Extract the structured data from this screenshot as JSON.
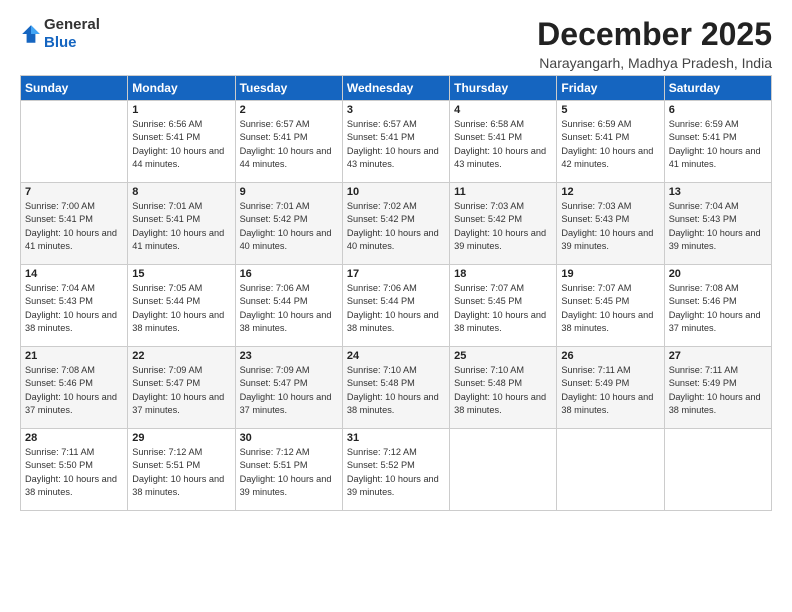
{
  "logo": {
    "general": "General",
    "blue": "Blue"
  },
  "header": {
    "month": "December 2025",
    "location": "Narayangarh, Madhya Pradesh, India"
  },
  "days_of_week": [
    "Sunday",
    "Monday",
    "Tuesday",
    "Wednesday",
    "Thursday",
    "Friday",
    "Saturday"
  ],
  "weeks": [
    [
      {
        "day": "",
        "content": ""
      },
      {
        "day": "1",
        "content": "Sunrise: 6:56 AM\nSunset: 5:41 PM\nDaylight: 10 hours\nand 44 minutes."
      },
      {
        "day": "2",
        "content": "Sunrise: 6:57 AM\nSunset: 5:41 PM\nDaylight: 10 hours\nand 44 minutes."
      },
      {
        "day": "3",
        "content": "Sunrise: 6:57 AM\nSunset: 5:41 PM\nDaylight: 10 hours\nand 43 minutes."
      },
      {
        "day": "4",
        "content": "Sunrise: 6:58 AM\nSunset: 5:41 PM\nDaylight: 10 hours\nand 43 minutes."
      },
      {
        "day": "5",
        "content": "Sunrise: 6:59 AM\nSunset: 5:41 PM\nDaylight: 10 hours\nand 42 minutes."
      },
      {
        "day": "6",
        "content": "Sunrise: 6:59 AM\nSunset: 5:41 PM\nDaylight: 10 hours\nand 41 minutes."
      }
    ],
    [
      {
        "day": "7",
        "content": "Sunrise: 7:00 AM\nSunset: 5:41 PM\nDaylight: 10 hours\nand 41 minutes."
      },
      {
        "day": "8",
        "content": "Sunrise: 7:01 AM\nSunset: 5:41 PM\nDaylight: 10 hours\nand 41 minutes."
      },
      {
        "day": "9",
        "content": "Sunrise: 7:01 AM\nSunset: 5:42 PM\nDaylight: 10 hours\nand 40 minutes."
      },
      {
        "day": "10",
        "content": "Sunrise: 7:02 AM\nSunset: 5:42 PM\nDaylight: 10 hours\nand 40 minutes."
      },
      {
        "day": "11",
        "content": "Sunrise: 7:03 AM\nSunset: 5:42 PM\nDaylight: 10 hours\nand 39 minutes."
      },
      {
        "day": "12",
        "content": "Sunrise: 7:03 AM\nSunset: 5:43 PM\nDaylight: 10 hours\nand 39 minutes."
      },
      {
        "day": "13",
        "content": "Sunrise: 7:04 AM\nSunset: 5:43 PM\nDaylight: 10 hours\nand 39 minutes."
      }
    ],
    [
      {
        "day": "14",
        "content": "Sunrise: 7:04 AM\nSunset: 5:43 PM\nDaylight: 10 hours\nand 38 minutes."
      },
      {
        "day": "15",
        "content": "Sunrise: 7:05 AM\nSunset: 5:44 PM\nDaylight: 10 hours\nand 38 minutes."
      },
      {
        "day": "16",
        "content": "Sunrise: 7:06 AM\nSunset: 5:44 PM\nDaylight: 10 hours\nand 38 minutes."
      },
      {
        "day": "17",
        "content": "Sunrise: 7:06 AM\nSunset: 5:44 PM\nDaylight: 10 hours\nand 38 minutes."
      },
      {
        "day": "18",
        "content": "Sunrise: 7:07 AM\nSunset: 5:45 PM\nDaylight: 10 hours\nand 38 minutes."
      },
      {
        "day": "19",
        "content": "Sunrise: 7:07 AM\nSunset: 5:45 PM\nDaylight: 10 hours\nand 38 minutes."
      },
      {
        "day": "20",
        "content": "Sunrise: 7:08 AM\nSunset: 5:46 PM\nDaylight: 10 hours\nand 37 minutes."
      }
    ],
    [
      {
        "day": "21",
        "content": "Sunrise: 7:08 AM\nSunset: 5:46 PM\nDaylight: 10 hours\nand 37 minutes."
      },
      {
        "day": "22",
        "content": "Sunrise: 7:09 AM\nSunset: 5:47 PM\nDaylight: 10 hours\nand 37 minutes."
      },
      {
        "day": "23",
        "content": "Sunrise: 7:09 AM\nSunset: 5:47 PM\nDaylight: 10 hours\nand 37 minutes."
      },
      {
        "day": "24",
        "content": "Sunrise: 7:10 AM\nSunset: 5:48 PM\nDaylight: 10 hours\nand 38 minutes."
      },
      {
        "day": "25",
        "content": "Sunrise: 7:10 AM\nSunset: 5:48 PM\nDaylight: 10 hours\nand 38 minutes."
      },
      {
        "day": "26",
        "content": "Sunrise: 7:11 AM\nSunset: 5:49 PM\nDaylight: 10 hours\nand 38 minutes."
      },
      {
        "day": "27",
        "content": "Sunrise: 7:11 AM\nSunset: 5:49 PM\nDaylight: 10 hours\nand 38 minutes."
      }
    ],
    [
      {
        "day": "28",
        "content": "Sunrise: 7:11 AM\nSunset: 5:50 PM\nDaylight: 10 hours\nand 38 minutes."
      },
      {
        "day": "29",
        "content": "Sunrise: 7:12 AM\nSunset: 5:51 PM\nDaylight: 10 hours\nand 38 minutes."
      },
      {
        "day": "30",
        "content": "Sunrise: 7:12 AM\nSunset: 5:51 PM\nDaylight: 10 hours\nand 39 minutes."
      },
      {
        "day": "31",
        "content": "Sunrise: 7:12 AM\nSunset: 5:52 PM\nDaylight: 10 hours\nand 39 minutes."
      },
      {
        "day": "",
        "content": ""
      },
      {
        "day": "",
        "content": ""
      },
      {
        "day": "",
        "content": ""
      }
    ]
  ]
}
